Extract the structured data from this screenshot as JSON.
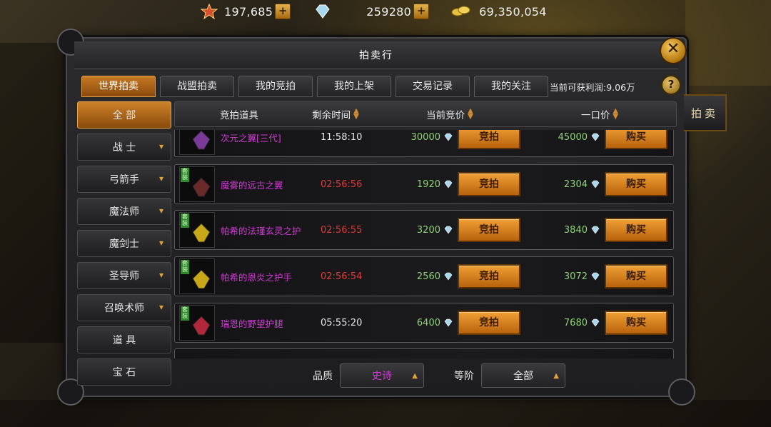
{
  "currency": [
    {
      "icon": "medal-icon",
      "value": "197,685",
      "plus": true
    },
    {
      "icon": "diamond-icon",
      "value": "259280",
      "plus": true
    },
    {
      "icon": "gold-coins-icon",
      "value": "69,350,054",
      "plus": false
    }
  ],
  "window": {
    "title": "拍卖行",
    "profit_label": "当前可获利润:9.06万",
    "help": "?",
    "close": "✕"
  },
  "tabs": [
    {
      "label": "世界拍卖",
      "active": true
    },
    {
      "label": "战盟拍卖",
      "active": false
    },
    {
      "label": "我的竞拍",
      "active": false
    },
    {
      "label": "我的上架",
      "active": false
    },
    {
      "label": "交易记录",
      "active": false
    },
    {
      "label": "我的关注",
      "active": false
    }
  ],
  "sidebar": [
    {
      "label": "全 部",
      "active": true,
      "expandable": false
    },
    {
      "label": "战 士",
      "active": false,
      "expandable": true
    },
    {
      "label": "弓箭手",
      "active": false,
      "expandable": true
    },
    {
      "label": "魔法师",
      "active": false,
      "expandable": true
    },
    {
      "label": "魔剑士",
      "active": false,
      "expandable": true
    },
    {
      "label": "圣导师",
      "active": false,
      "expandable": true
    },
    {
      "label": "召唤术师",
      "active": false,
      "expandable": true
    },
    {
      "label": "道 具",
      "active": false,
      "expandable": false
    },
    {
      "label": "宝 石",
      "active": false,
      "expandable": false
    }
  ],
  "table": {
    "headers": {
      "item": "竞拍道具",
      "time": "剩余时间",
      "bid": "当前竞价",
      "buyout": "一口价"
    },
    "bid_button": "竞拍",
    "buy_button": "购买",
    "rows": [
      {
        "name": "次元之翼[三代]",
        "time": "11:58:10",
        "time_urgent": false,
        "bid": "30000",
        "buyout": "45000",
        "tag": "",
        "art_color": "#7a3a9a"
      },
      {
        "name": "魔雾的远古之翼",
        "time": "02:56:56",
        "time_urgent": true,
        "bid": "1920",
        "buyout": "2304",
        "tag": "套装",
        "art_color": "#6a2a2a"
      },
      {
        "name": "帕希的法瑾玄灵之护",
        "time": "02:56:55",
        "time_urgent": true,
        "bid": "3200",
        "buyout": "3840",
        "tag": "套装",
        "art_color": "#c8a818"
      },
      {
        "name": "帕希的恩炎之护手",
        "time": "02:56:54",
        "time_urgent": true,
        "bid": "2560",
        "buyout": "3072",
        "tag": "套装",
        "art_color": "#c8a818"
      },
      {
        "name": "瑞恩的野望护腿",
        "time": "05:55:20",
        "time_urgent": false,
        "bid": "6400",
        "buyout": "7680",
        "tag": "套装",
        "art_color": "#b0283a"
      }
    ]
  },
  "footer": {
    "quality_label": "品质",
    "quality_value": "史诗",
    "tier_label": "等阶",
    "tier_value": "全部"
  },
  "side_button": "拍卖",
  "colors": {
    "accent_orange": "#c67a22",
    "item_name": "#d23ad6",
    "price_green": "#8fd07a",
    "time_red": "#e03a3a"
  }
}
